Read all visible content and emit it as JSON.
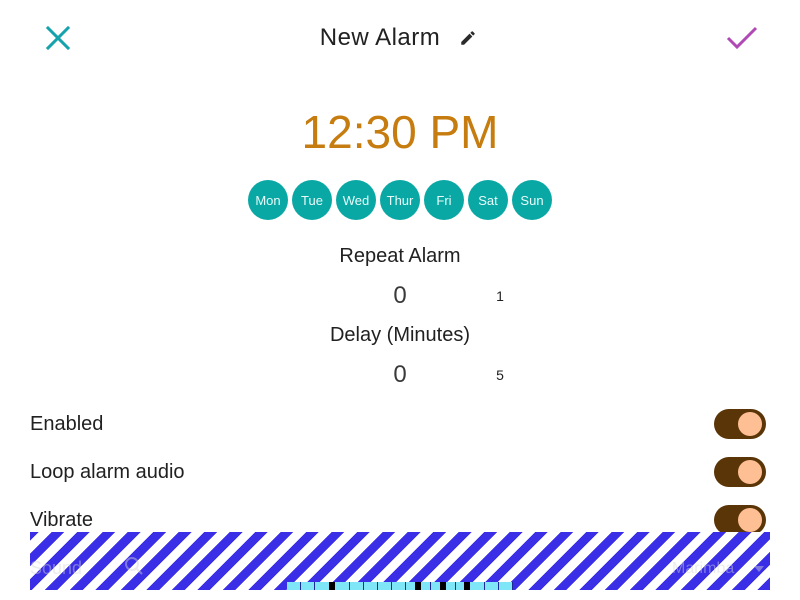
{
  "header": {
    "title": "New Alarm",
    "close_icon": "close-icon",
    "edit_icon": "pencil-icon",
    "confirm_icon": "checkmark-icon",
    "close_color": "#14a3ad",
    "confirm_color": "#b048b5"
  },
  "alarm": {
    "time": "12:30 PM",
    "time_color": "#c67c0e"
  },
  "days": [
    {
      "label": "Mon"
    },
    {
      "label": "Tue"
    },
    {
      "label": "Wed"
    },
    {
      "label": "Thur"
    },
    {
      "label": "Fri"
    },
    {
      "label": "Sat"
    },
    {
      "label": "Sun"
    }
  ],
  "day_color": "#0aa8a4",
  "repeat": {
    "label": "Repeat Alarm",
    "value": "0",
    "aux": "1"
  },
  "delay": {
    "label": "Delay (Minutes)",
    "value": "0",
    "aux": "5"
  },
  "settings": [
    {
      "label": "Enabled",
      "on": true
    },
    {
      "label": "Loop alarm audio",
      "on": true
    },
    {
      "label": "Vibrate",
      "on": true
    }
  ],
  "toggle_colors": {
    "track": "#5a3508",
    "thumb": "#ffbf94"
  },
  "sound": {
    "label": "Sound",
    "value": "Marimba",
    "search_icon": "search-icon",
    "dropdown_icon": "chevron-down-icon"
  },
  "overlay_colors": {
    "stripe": "#3a2ee6",
    "marquee": "#7fe6f7"
  }
}
